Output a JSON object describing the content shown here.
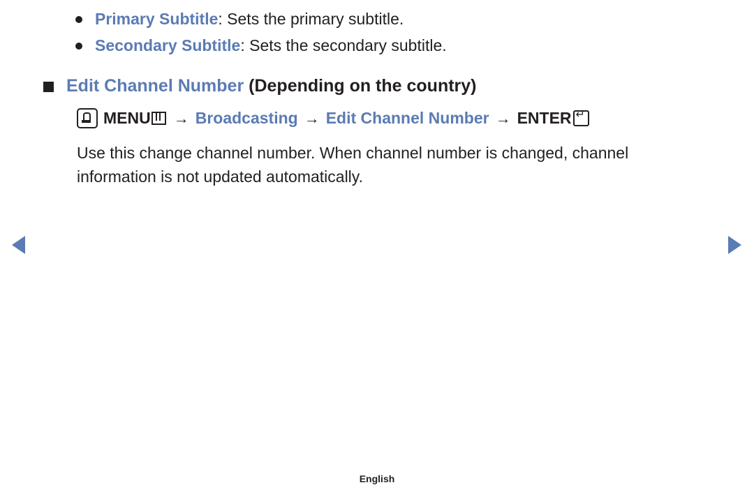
{
  "bullets": [
    {
      "term": "Primary Subtitle",
      "description": ": Sets the primary subtitle."
    },
    {
      "term": "Secondary Subtitle",
      "description": ": Sets the secondary subtitle."
    }
  ],
  "section": {
    "title_blue": "Edit Channel Number",
    "title_black": " (Depending on the country)"
  },
  "menu_path": {
    "oo_label": "OO",
    "menu_label": "MENU",
    "arrow": "→",
    "step2": "Broadcasting",
    "step3": "Edit Channel Number",
    "enter_label": "ENTER"
  },
  "body": {
    "paragraph": "Use this change channel number. When channel number is changed, channel information is not updated automatically."
  },
  "navigation": {
    "previous": "previous-page",
    "next": "next-page"
  },
  "footer": {
    "language": "English"
  },
  "colors": {
    "accent_blue": "#5b7bb4",
    "text_black": "#231f20",
    "background": "#ffffff"
  }
}
